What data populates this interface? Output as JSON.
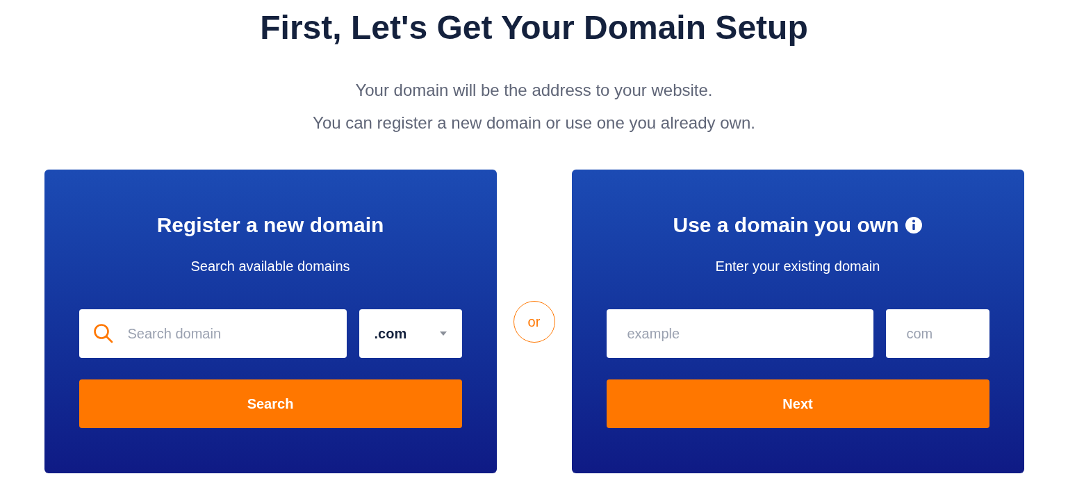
{
  "heading": "First, Let's Get Your Domain Setup",
  "intro": [
    "Your domain will be the address to your website.",
    "You can register a new domain or use one you already own."
  ],
  "cards": [
    {
      "title": "Register a new domain",
      "info": false,
      "subtitle": "Search available domains",
      "fields": [
        {
          "kind": "search",
          "placeholder": "Search domain"
        },
        {
          "kind": "select",
          "value": ".com"
        }
      ],
      "button": "Search"
    },
    {
      "title": "Use a domain you own",
      "info": true,
      "subtitle": "Enter your existing domain",
      "fields": [
        {
          "kind": "text",
          "placeholder": "example"
        },
        {
          "kind": "text",
          "placeholder": "com"
        }
      ],
      "button": "Next"
    }
  ],
  "divider": "or"
}
